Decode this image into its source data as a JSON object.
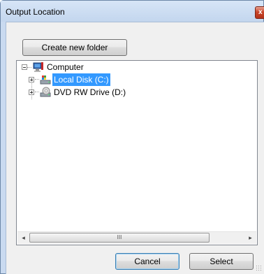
{
  "window": {
    "title": "Output Location",
    "close_glyph": "x"
  },
  "toolbar": {
    "create_folder_label": "Create new folder"
  },
  "tree": {
    "items": [
      {
        "label": "Computer",
        "icon": "computer-icon",
        "expanded": true,
        "selected": false
      },
      {
        "label": "Local Disk (C:)",
        "icon": "local-disk-icon",
        "expanded": false,
        "selected": true
      },
      {
        "label": "DVD RW Drive (D:)",
        "icon": "dvd-drive-icon",
        "expanded": false,
        "selected": false
      }
    ]
  },
  "scrollbar": {
    "left_glyph": "◂",
    "right_glyph": "▸",
    "thumb_grip": "III"
  },
  "footer": {
    "cancel_label": "Cancel",
    "select_label": "Select"
  },
  "colors": {
    "selection": "#3399ff",
    "window_frame": "#c9daf0",
    "client_bg": "#f0f0f0"
  }
}
